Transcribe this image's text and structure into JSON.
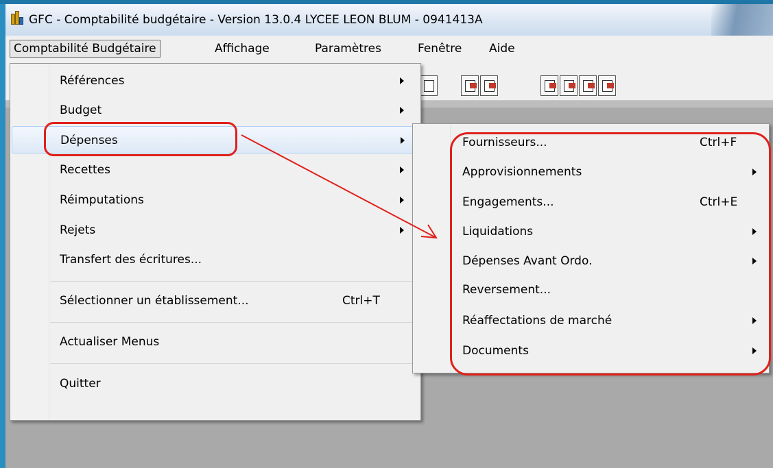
{
  "window": {
    "title": "GFC - Comptabilité budgétaire - Version 13.0.4   LYCEE LEON BLUM - 0941413A",
    "icon": "bar-chart-icon"
  },
  "menubar": {
    "items": [
      {
        "label": "Comptabilité Budgétaire"
      },
      {
        "label": "Affichage"
      },
      {
        "label": "Paramètres"
      },
      {
        "label": "Fenêtre"
      },
      {
        "label": "Aide"
      }
    ]
  },
  "main_menu": {
    "items": [
      {
        "label": "Références",
        "has_submenu": true
      },
      {
        "label": "Budget",
        "has_submenu": true
      },
      {
        "label": "Dépenses",
        "has_submenu": true,
        "highlighted": true
      },
      {
        "label": "Recettes",
        "has_submenu": true
      },
      {
        "label": "Réimputations",
        "has_submenu": true
      },
      {
        "label": "Rejets",
        "has_submenu": true
      },
      {
        "label": "Transfert des écritures..."
      },
      {
        "label": "Sélectionner un établissement...",
        "shortcut": "Ctrl+T"
      },
      {
        "label": "Actualiser Menus"
      },
      {
        "label": "Quitter"
      }
    ]
  },
  "submenu": {
    "items": [
      {
        "label": "Fournisseurs...",
        "shortcut": "Ctrl+F"
      },
      {
        "label": "Approvisionnements",
        "has_submenu": true
      },
      {
        "label": "Engagements...",
        "shortcut": "Ctrl+E"
      },
      {
        "label": "Liquidations",
        "has_submenu": true
      },
      {
        "label": "Dépenses Avant Ordo.",
        "has_submenu": true
      },
      {
        "label": "Reversement..."
      },
      {
        "label": "Réaffectations de marché",
        "has_submenu": true
      },
      {
        "label": "Documents",
        "has_submenu": true
      }
    ]
  },
  "colors": {
    "annotation": "#e0201a",
    "highlight": "#dde9f7",
    "workspace": "#a9a9a9"
  }
}
